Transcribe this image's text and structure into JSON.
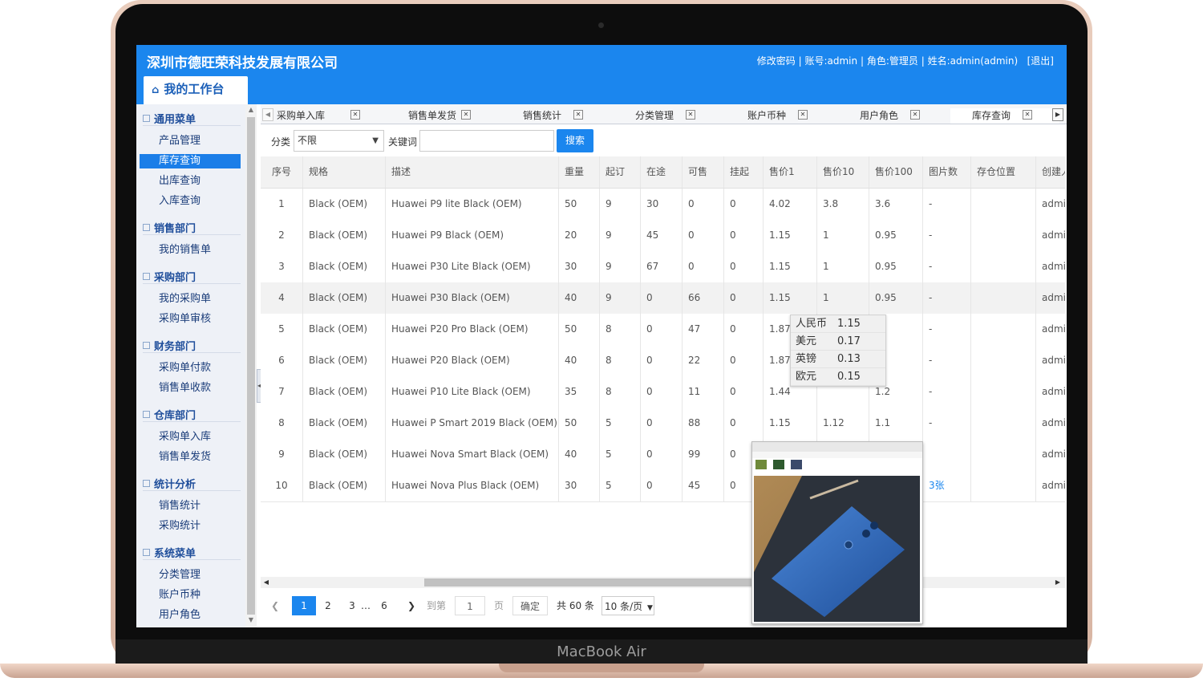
{
  "device_label": "MacBook Air",
  "header": {
    "company": "深圳市德旺荣科技发展有限公司",
    "change_password": "修改密码",
    "sep": "|",
    "account": "账号:admin",
    "role": "角色:管理员",
    "name": "姓名:admin(admin)",
    "logout": "[退出]",
    "workbench": "我的工作台"
  },
  "sidebar": {
    "sections": [
      {
        "title": "通用菜单",
        "items": [
          "产品管理",
          "库存查询",
          "出库查询",
          "入库查询"
        ]
      },
      {
        "title": "销售部门",
        "items": [
          "我的销售单"
        ]
      },
      {
        "title": "采购部门",
        "items": [
          "我的采购单",
          "采购单审核"
        ]
      },
      {
        "title": "财务部门",
        "items": [
          "采购单付款",
          "销售单收款"
        ]
      },
      {
        "title": "仓库部门",
        "items": [
          "采购单入库",
          "销售单发货"
        ]
      },
      {
        "title": "统计分析",
        "items": [
          "销售统计",
          "采购统计"
        ]
      },
      {
        "title": "系统菜单",
        "items": [
          "分类管理",
          "账户币种",
          "用户角色"
        ]
      }
    ],
    "active_item": "库存查询"
  },
  "tabs": [
    "采购单入库",
    "销售单发货",
    "销售统计",
    "分类管理",
    "账户币种",
    "用户角色",
    "库存查询"
  ],
  "active_tab": "库存查询",
  "filter": {
    "category_label": "分类",
    "category_value": "不限",
    "keyword_label": "关键词",
    "keyword_value": "",
    "search_label": "搜索"
  },
  "table": {
    "columns": [
      "序号",
      "规格",
      "描述",
      "重量",
      "起订",
      "在途",
      "可售",
      "挂起",
      "售价1",
      "售价10",
      "售价100",
      "图片数",
      "存仓位置",
      "创建人"
    ],
    "rows": [
      [
        "1",
        "Black (OEM)",
        "Huawei P9 lite Black (OEM)",
        "50",
        "9",
        "30",
        "0",
        "0",
        "4.02",
        "3.8",
        "3.6",
        "-",
        "",
        "admin"
      ],
      [
        "2",
        "Black (OEM)",
        "Huawei P9 Black (OEM)",
        "20",
        "9",
        "45",
        "0",
        "0",
        "1.15",
        "1",
        "0.95",
        "-",
        "",
        "admin"
      ],
      [
        "3",
        "Black (OEM)",
        "Huawei P30 Lite Black (OEM)",
        "30",
        "9",
        "67",
        "0",
        "0",
        "1.15",
        "1",
        "0.95",
        "-",
        "",
        "admin"
      ],
      [
        "4",
        "Black (OEM)",
        "Huawei P30 Black (OEM)",
        "40",
        "9",
        "0",
        "66",
        "0",
        "1.15",
        "1",
        "0.95",
        "-",
        "",
        "admin"
      ],
      [
        "5",
        "Black (OEM)",
        "Huawei P20 Pro Black (OEM)",
        "50",
        "8",
        "0",
        "47",
        "0",
        "1.87",
        "",
        "",
        "-",
        "",
        "admin"
      ],
      [
        "6",
        "Black (OEM)",
        "Huawei P20 Black (OEM)",
        "40",
        "8",
        "0",
        "22",
        "0",
        "1.87",
        "",
        "",
        "-",
        "",
        "admin"
      ],
      [
        "7",
        "Black (OEM)",
        "Huawei P10 Lite Black (OEM)",
        "35",
        "8",
        "0",
        "11",
        "0",
        "1.44",
        "",
        "1.2",
        "-",
        "",
        "admin"
      ],
      [
        "8",
        "Black (OEM)",
        "Huawei P Smart 2019 Black (OEM)",
        "50",
        "5",
        "0",
        "88",
        "0",
        "1.15",
        "1.12",
        "1.1",
        "-",
        "",
        "admin"
      ],
      [
        "9",
        "Black (OEM)",
        "Huawei Nova Smart Black (OEM)",
        "40",
        "5",
        "0",
        "99",
        "0",
        "",
        "",
        "",
        "",
        "",
        "admin"
      ],
      [
        "10",
        "Black (OEM)",
        "Huawei Nova Plus Black (OEM)",
        "30",
        "5",
        "0",
        "45",
        "0",
        "",
        "",
        "",
        "3张",
        "",
        "admin"
      ]
    ],
    "highlighted_row": 4
  },
  "currency_popup": [
    {
      "name": "人民币",
      "value": "1.15"
    },
    {
      "name": "美元",
      "value": "0.17"
    },
    {
      "name": "英镑",
      "value": "0.13"
    },
    {
      "name": "欧元",
      "value": "0.15"
    }
  ],
  "pager": {
    "pages": [
      "1",
      "2",
      "3",
      "6"
    ],
    "current": "1",
    "ellipsis": "…",
    "goto_label": "到第",
    "goto_value": "1",
    "page_unit": "页",
    "confirm": "确定",
    "total": "共 60 条",
    "page_size": "10 条/页"
  },
  "colors": {
    "brand": "#1b86ee",
    "sidebar_bg": "#eef1f7",
    "active_item": "#1b7ee8"
  }
}
